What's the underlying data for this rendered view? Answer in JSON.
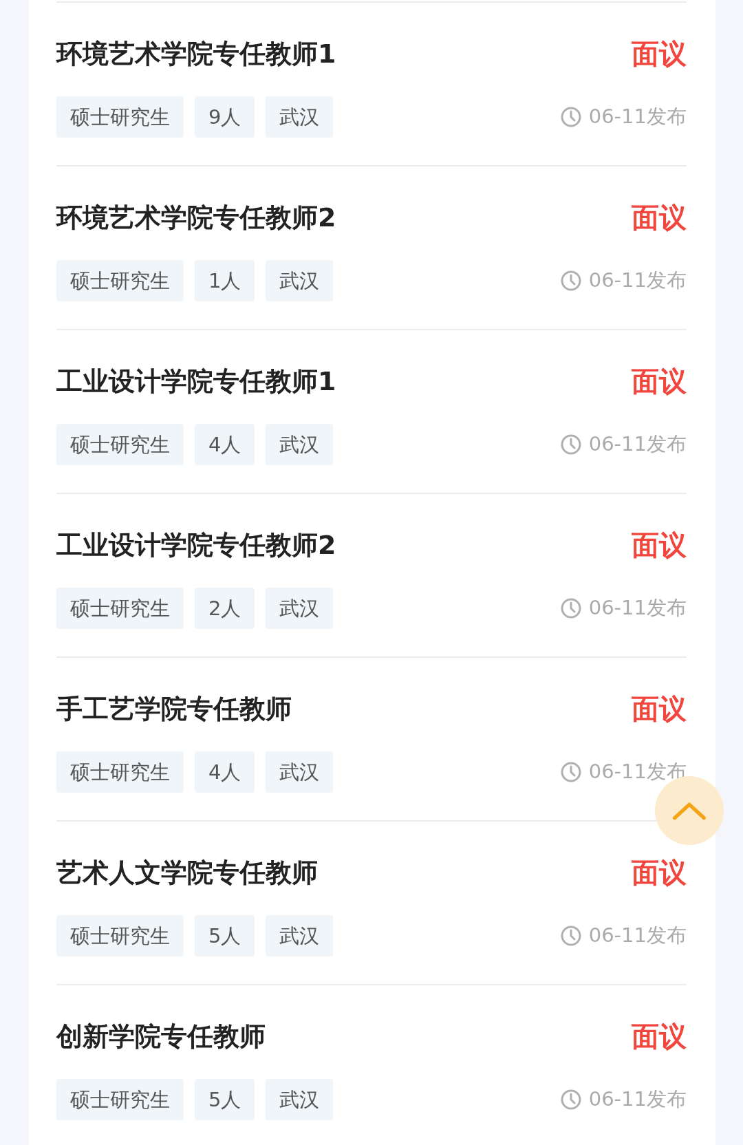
{
  "jobs": [
    {
      "title": "环境艺术学院专任教师1",
      "salary": "面议",
      "tags": [
        "硕士研究生",
        "9人",
        "武汉"
      ],
      "date": "06-11发布"
    },
    {
      "title": "环境艺术学院专任教师2",
      "salary": "面议",
      "tags": [
        "硕士研究生",
        "1人",
        "武汉"
      ],
      "date": "06-11发布"
    },
    {
      "title": "工业设计学院专任教师1",
      "salary": "面议",
      "tags": [
        "硕士研究生",
        "4人",
        "武汉"
      ],
      "date": "06-11发布"
    },
    {
      "title": "工业设计学院专任教师2",
      "salary": "面议",
      "tags": [
        "硕士研究生",
        "2人",
        "武汉"
      ],
      "date": "06-11发布"
    },
    {
      "title": "手工艺学院专任教师",
      "salary": "面议",
      "tags": [
        "硕士研究生",
        "4人",
        "武汉"
      ],
      "date": "06-11发布"
    },
    {
      "title": "艺术人文学院专任教师",
      "salary": "面议",
      "tags": [
        "硕士研究生",
        "5人",
        "武汉"
      ],
      "date": "06-11发布"
    },
    {
      "title": "创新学院专任教师",
      "salary": "面议",
      "tags": [
        "硕士研究生",
        "5人",
        "武汉"
      ],
      "date": "06-11发布"
    }
  ]
}
